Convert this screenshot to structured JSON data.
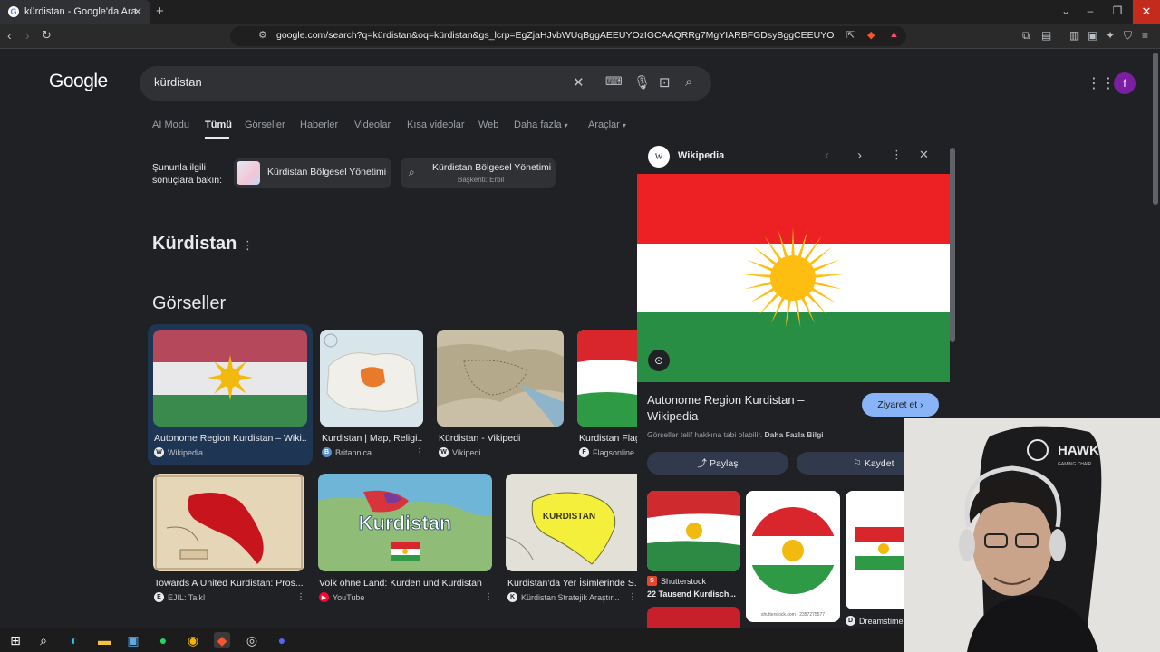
{
  "browser": {
    "tab_title": "kürdistan - Google'da Ara",
    "url": "google.com/search?q=kürdistan&oq=kürdistan&gs_lcrp=EgZjaHJvbWUqBggAEEUYOzIGCAAQRRg7MgYIARBFGDsyBggCEEUYOzIGCAMQRRg9MgYI..."
  },
  "google": {
    "logo": "Google",
    "query": "kürdistan",
    "avatar_letter": "f",
    "tabs": [
      "AI Modu",
      "Tümü",
      "Görseller",
      "Haberler",
      "Videolar",
      "Kısa videolar",
      "Web",
      "Daha fazla",
      "Araçlar"
    ],
    "see_results_label": "Şununla ilgili sonuçlara bakın:",
    "chip1": "Kürdistan Bölgesel Yönetimi",
    "chip2_title": "Kürdistan Bölgesel Yönetimi",
    "chip2_sub": "Başkenti: Erbil",
    "entity_title": "Kürdistan",
    "images_heading": "Görseller"
  },
  "images": [
    {
      "title": "Autonome Region Kurdistan – Wiki...",
      "source": "Wikipedia"
    },
    {
      "title": "Kurdistan | Map, Religi...",
      "source": "Britannica"
    },
    {
      "title": "Kürdistan - Vikipedi",
      "source": "Vikipedi"
    },
    {
      "title": "Kurdistan Flag",
      "source": "Flagsonline."
    },
    {
      "title": "Towards A United Kurdistan: Pros...",
      "source": "EJIL: Talk!"
    },
    {
      "title": "Volk ohne Land: Kurden und Kurdistan",
      "source": "YouTube"
    },
    {
      "title": "Kürdistan'da Yer İsimlerinde S...",
      "source": "Kürdistan Stratejik Araştır..."
    }
  ],
  "image_overlays": {
    "kurdistan_video": "Kurdistan",
    "kurdistan_map": "KURDISTAN"
  },
  "panel": {
    "source": "Wikipedia",
    "title": "Autonome Region Kurdistan – Wikipedia",
    "visit_label": "Ziyaret et",
    "copyright": "Görseller telif hakkına tabi olabilir.",
    "more_info": "Daha Fazla Bilgi",
    "share_label": "Paylaş",
    "save_label": "Kaydet",
    "related": [
      {
        "source": "Shutterstock",
        "title": "22 Tausend Kurdisch..."
      },
      {
        "source": "shutterstock.com · 2357275577",
        "title": ""
      },
      {
        "source": "Dreamstime",
        "title": ""
      }
    ]
  },
  "webcam": {
    "chair_brand": "HAWK",
    "chair_sub": "GAMING CHAIR"
  },
  "colors": {
    "flag_red": "#ED2024",
    "flag_white": "#FFFFFF",
    "flag_green": "#278E43",
    "sun": "#FEBD11",
    "accent_blue": "#8ab4f8"
  }
}
